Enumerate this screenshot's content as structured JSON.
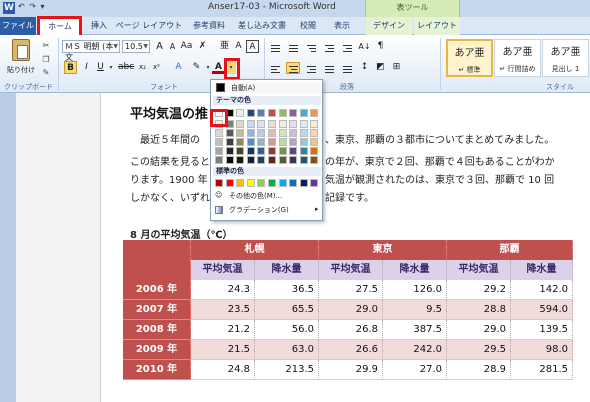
{
  "window": {
    "title": "Anser17-03 - Microsoft Word",
    "app_icon": "W",
    "qat": "↶ ↷ ▾"
  },
  "tabs": {
    "file": "ファイル",
    "home": "ホーム",
    "insert": "挿入",
    "page_layout": "ページ レイアウト",
    "references": "参考資料",
    "mailings": "差し込み文書",
    "review": "校閲",
    "view": "表示",
    "table_tools_title": "表ツール",
    "design": "デザイン",
    "layout": "レイアウト"
  },
  "ribbon": {
    "paste_label": "貼り付け",
    "clipboard_label": "クリップボード",
    "font_group_label": "フォント",
    "paragraph_group_label": "段落",
    "style_group_label": "スタイル",
    "font_name": "ＭＳ 明朝 (本文",
    "font_size": "10.5",
    "bold": "B",
    "italic": "I",
    "underline": "U",
    "text_color_glyph": "A",
    "styles": [
      {
        "sample": "あア亜",
        "name": "↵ 標準"
      },
      {
        "sample": "あア亜",
        "name": "↵ 行間詰め"
      },
      {
        "sample": "あア亜",
        "name": "見出し 1"
      }
    ]
  },
  "document": {
    "heading": "平均気温の推",
    "paragraphs": [
      "　最近５年間の",
      "この結果を見ると",
      "ります。1900 年",
      "しかなく、いずれ"
    ],
    "paragraph_tails": [
      "、東京、那覇の３都市についてまとめてみました。",
      "の年が、東京で２回、那覇で４回もあることがわか",
      "気温が観測されたのは、東京で３回、那覇で 10 回",
      "記録です。"
    ],
    "table_caption": "8 月の平均気温（℃）"
  },
  "table": {
    "cities": [
      "札幌",
      "東京",
      "那覇"
    ],
    "subheaders": [
      "平均気温",
      "降水量"
    ],
    "rows": [
      {
        "year": "2006 年",
        "values": [
          "24.3",
          "36.5",
          "27.5",
          "126.0",
          "29.2",
          "142.0"
        ]
      },
      {
        "year": "2007 年",
        "values": [
          "23.5",
          "65.5",
          "29.0",
          "9.5",
          "28.8",
          "594.0"
        ]
      },
      {
        "year": "2008 年",
        "values": [
          "21.2",
          "56.0",
          "26.8",
          "387.5",
          "29.0",
          "139.5"
        ]
      },
      {
        "year": "2009 年",
        "values": [
          "21.5",
          "63.0",
          "26.6",
          "242.0",
          "29.5",
          "98.0"
        ]
      },
      {
        "year": "2010 年",
        "values": [
          "24.8",
          "213.5",
          "29.9",
          "27.0",
          "28.9",
          "281.5"
        ]
      }
    ]
  },
  "color_dropdown": {
    "auto_label": "自動(A)",
    "theme_header": "テーマの色",
    "standard_header": "標準の色",
    "more_colors": "その他の色(M)...",
    "gradient": "グラデーション(G)",
    "theme_colors": [
      "#ffffff",
      "#000000",
      "#eeece1",
      "#1f497d",
      "#4f81bd",
      "#c0504d",
      "#9bbb59",
      "#8064a2",
      "#4bacc6",
      "#f79646"
    ],
    "theme_shades": [
      [
        "#f2f2f2",
        "#7f7f7f",
        "#ddd9c3",
        "#c6d9f0",
        "#dbe5f1",
        "#f2dcdb",
        "#ebf1dd",
        "#e5e0ec",
        "#dbeef3",
        "#fdeada"
      ],
      [
        "#d8d8d8",
        "#595959",
        "#c4bd97",
        "#8db3e2",
        "#b8cce4",
        "#e5b9b7",
        "#d7e3bc",
        "#ccc1d9",
        "#b7dde8",
        "#fbd5b5"
      ],
      [
        "#bfbfbf",
        "#3f3f3f",
        "#938953",
        "#548dd4",
        "#95b3d7",
        "#d99694",
        "#c3d69b",
        "#b2a2c7",
        "#92cddc",
        "#fac08f"
      ],
      [
        "#a5a5a5",
        "#262626",
        "#494429",
        "#17365d",
        "#366092",
        "#953734",
        "#76923c",
        "#5f497a",
        "#31859b",
        "#e36c09"
      ],
      [
        "#7f7f7f",
        "#0c0c0c",
        "#1d1b10",
        "#0f243e",
        "#244061",
        "#632423",
        "#4f6128",
        "#3f3151",
        "#205867",
        "#974806"
      ]
    ],
    "standard_colors": [
      "#c00000",
      "#ff0000",
      "#ffc000",
      "#ffff00",
      "#92d050",
      "#00b050",
      "#00b0f0",
      "#0070c0",
      "#002060",
      "#7030a0"
    ]
  }
}
